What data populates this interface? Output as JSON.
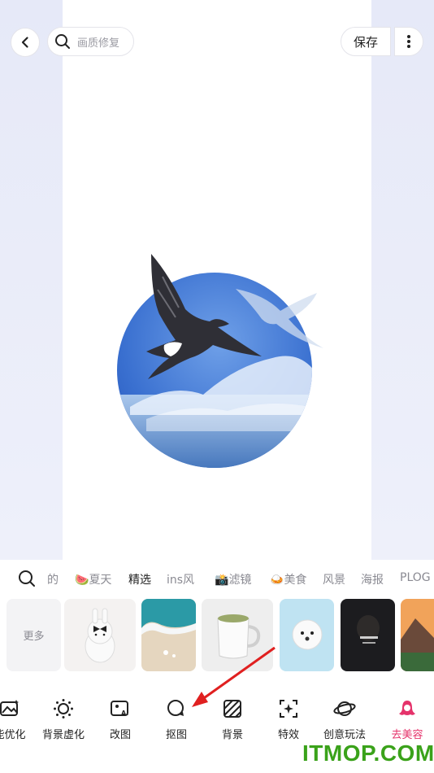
{
  "topbar": {
    "search_placeholder": "画质修复",
    "save_label": "保存"
  },
  "categories": [
    "的",
    "夏天",
    "精选",
    "ins风",
    "滤镜",
    "美食",
    "风景",
    "海报",
    "PLOG"
  ],
  "active_category": "精选",
  "thumbnails": {
    "more_label": "更多"
  },
  "tools": [
    {
      "label": "能优化",
      "icon": "smart-enhance-icon"
    },
    {
      "label": "背景虚化",
      "icon": "background-blur-icon"
    },
    {
      "label": "改图",
      "icon": "ai-edit-image-icon"
    },
    {
      "label": "抠图",
      "icon": "cutout-icon"
    },
    {
      "label": "背景",
      "icon": "background-icon"
    },
    {
      "label": "特效",
      "icon": "effects-icon"
    },
    {
      "label": "创意玩法",
      "icon": "creative-planet-icon"
    },
    {
      "label": "去美容",
      "icon": "beauty-icon"
    }
  ],
  "watermark": "ITMOP.COM",
  "colors": {
    "accent_pink": "#e5336b",
    "arrow_red": "#e02020",
    "watermark_green": "#3aa21a"
  }
}
